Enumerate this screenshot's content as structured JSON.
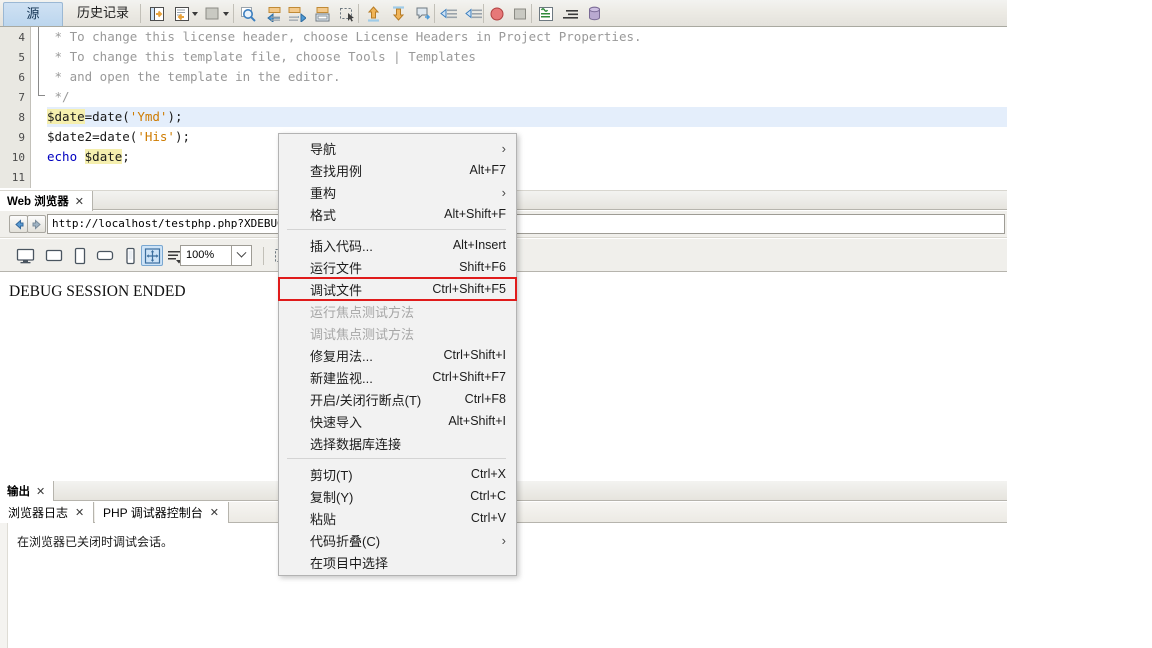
{
  "window": {
    "tabs": [
      {
        "label": "源",
        "name": "tab-source",
        "active": true
      },
      {
        "label": "历史记录",
        "name": "tab-history",
        "active": false
      }
    ]
  },
  "toolbar": {
    "buttons": [
      {
        "name": "go-to-source-icon",
        "title": "转到源"
      },
      {
        "name": "go-back-source-icon",
        "title": "上一个编辑位置"
      },
      {
        "name": "shift-left-icon",
        "title": "左移"
      },
      {
        "name": "find-selection-icon",
        "title": "查找选择"
      },
      {
        "name": "previous-bookmark-icon",
        "title": "上一个书签"
      },
      {
        "name": "next-bookmark-icon",
        "title": "下一个书签"
      },
      {
        "name": "toggle-bookmark-icon",
        "title": "切换书签"
      },
      {
        "name": "rectangular-selection-icon",
        "title": "矩形选择"
      },
      {
        "name": "shift-line-up-icon",
        "title": "上移行"
      },
      {
        "name": "shift-line-down-icon",
        "title": "下移行"
      },
      {
        "name": "comment-icon",
        "title": "注释"
      },
      {
        "name": "previous-error-icon",
        "title": "上一个错误"
      },
      {
        "name": "next-error-icon",
        "title": "下一个错误"
      },
      {
        "name": "stop-icon",
        "title": "停止"
      },
      {
        "name": "pause-icon",
        "title": "暂停"
      },
      {
        "name": "format-icon",
        "title": "格式化"
      },
      {
        "name": "shift-right-icon",
        "title": "右移"
      },
      {
        "name": "database-icon",
        "title": "数据库"
      }
    ]
  },
  "editor": {
    "line_numbers": [
      "4",
      "5",
      "6",
      "7",
      "8",
      "9",
      "10",
      "11"
    ],
    "highlighted_line_index": 4,
    "lines": [
      {
        "num": "4",
        "segments": [
          {
            "t": " * To change this license header, choose License Headers in Project Properties.",
            "c": "cmt"
          }
        ]
      },
      {
        "num": "5",
        "segments": [
          {
            "t": " * To change this template file, choose Tools | Templates",
            "c": "cmt"
          }
        ]
      },
      {
        "num": "6",
        "segments": [
          {
            "t": " * and open the template in the editor.",
            "c": "cmt"
          }
        ]
      },
      {
        "num": "7",
        "segments": [
          {
            "t": " */",
            "c": "cmt"
          }
        ]
      },
      {
        "num": "8",
        "segments": [
          {
            "t": "$date",
            "c": "var mark"
          },
          {
            "t": "=date(",
            "c": "fn"
          },
          {
            "t": "'Ymd'",
            "c": "str"
          },
          {
            "t": ");",
            "c": "fn"
          }
        ]
      },
      {
        "num": "9",
        "segments": [
          {
            "t": "$date2",
            "c": "var"
          },
          {
            "t": "=date(",
            "c": "fn"
          },
          {
            "t": "'His'",
            "c": "str"
          },
          {
            "t": ");",
            "c": "fn"
          }
        ]
      },
      {
        "num": "10",
        "segments": [
          {
            "t": "echo ",
            "c": "kw"
          },
          {
            "t": "$date",
            "c": "var mark"
          },
          {
            "t": ";",
            "c": "fn"
          }
        ]
      },
      {
        "num": "11",
        "segments": []
      }
    ]
  },
  "browser_panel": {
    "tab": {
      "label": "Web 浏览器",
      "close": "✕"
    },
    "back_label": "←",
    "forward_label": "→",
    "url": "http://localhost/testphp.php?XDEBUG_SE",
    "devices": [
      {
        "name": "device-desktop-icon",
        "selected": false
      },
      {
        "name": "device-laptop-icon",
        "selected": false
      },
      {
        "name": "device-tablet-portrait-icon",
        "selected": false
      },
      {
        "name": "device-tablet-landscape-icon",
        "selected": false
      },
      {
        "name": "device-phone-icon",
        "selected": false
      },
      {
        "name": "device-autosize-icon",
        "selected": true
      }
    ],
    "resize-list-icon": "resize-list-icon",
    "zoom": "100%",
    "inspect_label": "inspect-icon",
    "content_text": "DEBUG SESSION ENDED"
  },
  "output_panel": {
    "tab": {
      "label": "输出",
      "close": "✕"
    },
    "subtabs": [
      {
        "label": "浏览器日志",
        "close": "✕",
        "active": true
      },
      {
        "label": "PHP 调试器控制台",
        "close": "✕",
        "active": false
      }
    ],
    "log_line": "在浏览器已关闭时调试会话。"
  },
  "context_menu": {
    "highlight_color": "#e01b1b",
    "items": [
      {
        "label": "导航",
        "accel": "",
        "submenu": true,
        "disabled": false,
        "boxed": false,
        "name": "menu-item-navigate"
      },
      {
        "label": "查找用例",
        "accel": "Alt+F7",
        "submenu": false,
        "disabled": false,
        "boxed": false,
        "name": "menu-item-find-usages"
      },
      {
        "label": "重构",
        "accel": "",
        "submenu": true,
        "disabled": false,
        "boxed": false,
        "name": "menu-item-refactor"
      },
      {
        "label": "格式",
        "accel": "Alt+Shift+F",
        "submenu": false,
        "disabled": false,
        "boxed": false,
        "name": "menu-item-format"
      },
      {
        "separator": true
      },
      {
        "label": "插入代码...",
        "accel": "Alt+Insert",
        "submenu": false,
        "disabled": false,
        "boxed": false,
        "name": "menu-item-insert-code"
      },
      {
        "label": "运行文件",
        "accel": "Shift+F6",
        "submenu": false,
        "disabled": false,
        "boxed": false,
        "name": "menu-item-run-file"
      },
      {
        "label": "调试文件",
        "accel": "Ctrl+Shift+F5",
        "submenu": false,
        "disabled": false,
        "boxed": true,
        "name": "menu-item-debug-file"
      },
      {
        "label": "运行焦点测试方法",
        "accel": "",
        "submenu": false,
        "disabled": true,
        "boxed": false,
        "name": "menu-item-run-focused-test"
      },
      {
        "label": "调试焦点测试方法",
        "accel": "",
        "submenu": false,
        "disabled": true,
        "boxed": false,
        "name": "menu-item-debug-focused-test"
      },
      {
        "label": "修复用法...",
        "accel": "Ctrl+Shift+I",
        "submenu": false,
        "disabled": false,
        "boxed": false,
        "name": "menu-item-fix-imports"
      },
      {
        "label": "新建监视...",
        "accel": "Ctrl+Shift+F7",
        "submenu": false,
        "disabled": false,
        "boxed": false,
        "name": "menu-item-new-watch"
      },
      {
        "label": "开启/关闭行断点(T)",
        "accel": "Ctrl+F8",
        "submenu": false,
        "disabled": false,
        "boxed": false,
        "name": "menu-item-toggle-breakpoint"
      },
      {
        "label": "快速导入",
        "accel": "Alt+Shift+I",
        "submenu": false,
        "disabled": false,
        "boxed": false,
        "name": "menu-item-fast-import"
      },
      {
        "label": "选择数据库连接",
        "accel": "",
        "submenu": false,
        "disabled": false,
        "boxed": false,
        "name": "menu-item-select-db-connection"
      },
      {
        "separator": true
      },
      {
        "label": "剪切(T)",
        "accel": "Ctrl+X",
        "submenu": false,
        "disabled": false,
        "boxed": false,
        "name": "menu-item-cut"
      },
      {
        "label": "复制(Y)",
        "accel": "Ctrl+C",
        "submenu": false,
        "disabled": false,
        "boxed": false,
        "name": "menu-item-copy"
      },
      {
        "label": "粘贴",
        "accel": "Ctrl+V",
        "submenu": false,
        "disabled": false,
        "boxed": false,
        "name": "menu-item-paste"
      },
      {
        "label": "代码折叠(C)",
        "accel": "",
        "submenu": true,
        "disabled": false,
        "boxed": false,
        "name": "menu-item-code-folding"
      },
      {
        "label": "在项目中选择",
        "accel": "",
        "submenu": false,
        "disabled": false,
        "boxed": false,
        "name": "menu-item-select-in-projects"
      }
    ]
  }
}
